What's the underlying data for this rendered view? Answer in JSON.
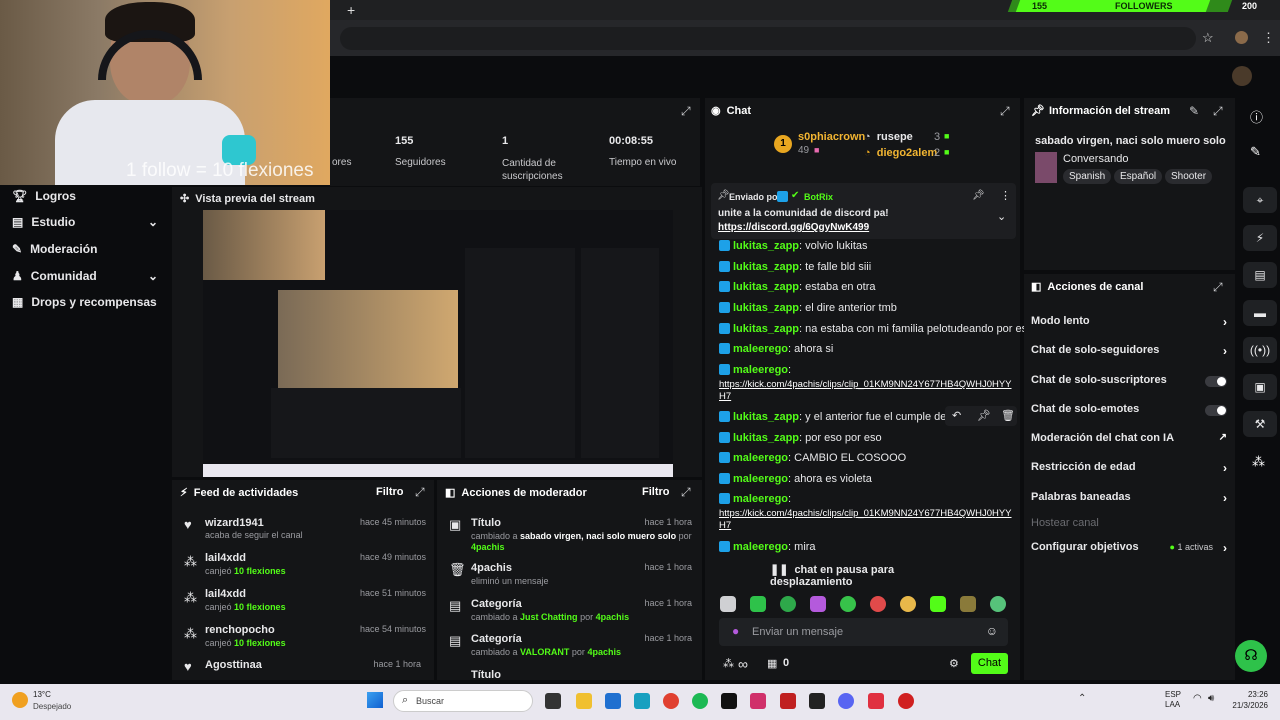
{
  "overlay": {
    "followers_count": "155",
    "followers_label": "FOLLOWERS",
    "goal": "200"
  },
  "cam": {
    "caption": "1 follow = 10 flexiones"
  },
  "stats": {
    "items": [
      {
        "value": "",
        "label": "ores"
      },
      {
        "value": "155",
        "label": "Seguidores"
      },
      {
        "value": "1",
        "label": "Cantidad de suscripciones"
      },
      {
        "value": "00:08:55",
        "label": "Tiempo en vivo"
      }
    ]
  },
  "sidebar": {
    "items": [
      {
        "label": "Logros"
      },
      {
        "label": "Estudio"
      },
      {
        "label": "Moderación"
      },
      {
        "label": "Comunidad"
      },
      {
        "label": "Drops y recompensas"
      }
    ]
  },
  "preview": {
    "title": "Vista previa del stream"
  },
  "feed": {
    "title": "Feed de actividades",
    "filter": "Filtro",
    "items": [
      {
        "user": "wizard1941",
        "desc": "acaba de seguir el canal",
        "hl": "",
        "time": "hace 45 minutos"
      },
      {
        "user": "lail4xdd",
        "desc": "canjeó",
        "hl": "10 flexiones",
        "time": "hace 49 minutos"
      },
      {
        "user": "lail4xdd",
        "desc": "canjeó",
        "hl": "10 flexiones",
        "time": "hace 51 minutos"
      },
      {
        "user": "renchopocho",
        "desc": "canjeó",
        "hl": "10 flexiones",
        "time": "hace 54 minutos"
      },
      {
        "user": "Agosttinaa",
        "desc": "",
        "hl": "",
        "time": "hace 1 hora"
      }
    ]
  },
  "modactions": {
    "title": "Acciones de moderador",
    "filter": "Filtro",
    "items": [
      {
        "type": "Título",
        "line1a": "cambiado a",
        "line1b": "sabado virgen, naci solo muero solo",
        "line1c": "por",
        "line2": "4pachis",
        "time": "hace 1 hora"
      },
      {
        "type": "4pachis",
        "line1a": "eliminó un mensaje",
        "line1b": "",
        "line1c": "",
        "line2": "",
        "time": "hace 1 hora"
      },
      {
        "type": "Categoría",
        "line1a": "cambiado a",
        "line1b": "Just Chatting",
        "line1c": "por",
        "line2": "4pachis",
        "time": "hace 1 hora"
      },
      {
        "type": "Categoría",
        "line1a": "cambiado a",
        "line1b": "VALORANT",
        "line1c": "por",
        "line2": "4pachis",
        "time": "hace 1 hora"
      },
      {
        "type": "Título",
        "line1a": "",
        "line1b": "",
        "line1c": "",
        "line2": "",
        "time": ""
      }
    ]
  },
  "chat": {
    "title": "Chat",
    "top": [
      {
        "rank": "1",
        "name": "s0phiacrown",
        "count": "49"
      },
      {
        "name": "rusepe",
        "count": "3"
      },
      {
        "name": "diego2alem",
        "count": "2"
      }
    ],
    "pinned": {
      "by_label": "Enviado por",
      "by": "BotRix",
      "text": "unite a la comunidad de discord pa!",
      "link": "https://discord.gg/6QgyNwK499"
    },
    "messages": [
      {
        "user": "lukitas_zapp",
        "text": "volvio lukitas"
      },
      {
        "user": "lukitas_zapp",
        "text": "te falle bld siii"
      },
      {
        "user": "lukitas_zapp",
        "text": "estaba en otra"
      },
      {
        "user": "lukitas_zapp",
        "text": "el dire anterior tmb"
      },
      {
        "user": "lukitas_zapp",
        "text": "na estaba con mi familia pelotudeando por eso"
      },
      {
        "user": "maleerego",
        "text": "ahora si"
      },
      {
        "user": "maleerego",
        "text": "",
        "link1": "https://kick.com/4pachis/clips/clip_01KM9NN24Y677HB4QWHJ0HYY",
        "link2": "H7"
      },
      {
        "user": "lukitas_zapp",
        "text": "y el anterior fue el cumple de mi prima"
      },
      {
        "user": "lukitas_zapp",
        "text": "por eso por eso"
      },
      {
        "user": "maleerego",
        "text": "CAMBIO EL COSOOO"
      },
      {
        "user": "maleerego",
        "text": "ahora es violeta"
      },
      {
        "user": "maleerego",
        "text": "",
        "link1": "https://kick.com/4pachis/clips/clip_01KM9NN24Y677HB4QWHJ0HYY",
        "link2": "H7"
      },
      {
        "user": "maleerego",
        "text": "mira"
      }
    ],
    "paused": "chat en pausa para desplazamiento",
    "input_placeholder": "Enviar un mensaje",
    "count": "0",
    "send": "Chat"
  },
  "info": {
    "title": "Información del stream",
    "stream_title": "sabado virgen, naci solo muero solo",
    "category": "Conversando",
    "tags": [
      "Spanish",
      "Español",
      "Shooter"
    ]
  },
  "channel_actions": {
    "title": "Acciones de canal",
    "items": [
      {
        "label": "Modo lento",
        "kind": "chevron"
      },
      {
        "label": "Chat de solo-seguidores",
        "kind": "chevron"
      },
      {
        "label": "Chat de solo-suscriptores",
        "kind": "toggle"
      },
      {
        "label": "Chat de solo-emotes",
        "kind": "toggle"
      },
      {
        "label": "Moderación del chat con IA",
        "kind": "ext"
      },
      {
        "label": "Restricción de edad",
        "kind": "chevron"
      },
      {
        "label": "Palabras baneadas",
        "kind": "chevron"
      },
      {
        "label": "Hostear canal",
        "kind": "disabled"
      },
      {
        "label": "Configurar objetivos",
        "kind": "chevron",
        "extra": "1 activas"
      }
    ]
  },
  "taskbar": {
    "temp": "13°C",
    "weather": "Despejado",
    "search": "Buscar",
    "lang1": "ESP",
    "lang2": "LAA",
    "time": "23:26",
    "date": "21/3/2026"
  },
  "colors": {
    "accent": "#53fc18",
    "panel": "#141517",
    "bg": "#0b0c0e"
  }
}
